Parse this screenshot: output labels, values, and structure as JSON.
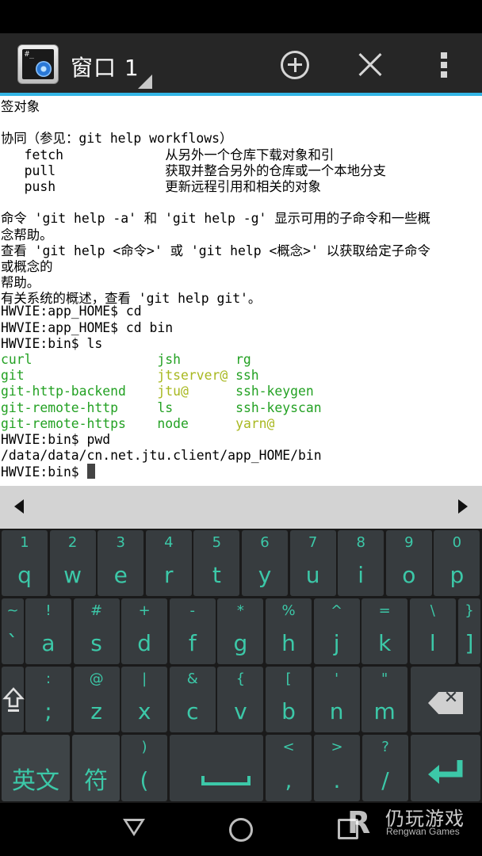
{
  "action_bar": {
    "title": "窗口 1",
    "icons": [
      "terminal-app-icon",
      "add-icon",
      "close-icon",
      "overflow-menu-icon"
    ]
  },
  "terminal": {
    "lines": [
      [
        {
          "t": "签对象",
          "c": ""
        }
      ],
      [
        {
          "t": "",
          "c": ""
        }
      ],
      [
        {
          "t": "协同（参见：git help workflows）",
          "c": ""
        }
      ],
      [
        {
          "t": "   fetch             从另外一个仓库下载对象和引",
          "c": ""
        }
      ],
      [
        {
          "t": "   pull              获取并整合另外的仓库或一个本地分支",
          "c": ""
        }
      ],
      [
        {
          "t": "   push              更新远程引用和相关的对象",
          "c": ""
        }
      ],
      [
        {
          "t": "",
          "c": ""
        }
      ],
      [
        {
          "t": "命令 'git help -a' 和 'git help -g' 显示可用的子命令和一些概",
          "c": ""
        }
      ],
      [
        {
          "t": "念帮助。",
          "c": ""
        }
      ],
      [
        {
          "t": "查看 'git help <命令>' 或 'git help <概念>' 以获取给定子命令",
          "c": ""
        }
      ],
      [
        {
          "t": "或概念的",
          "c": ""
        }
      ],
      [
        {
          "t": "帮助。",
          "c": ""
        }
      ],
      [
        {
          "t": "有关系统的概述，查看 'git help git'。",
          "c": ""
        }
      ],
      [
        {
          "t": "HWVIE:app_HOME$ cd",
          "c": ""
        }
      ],
      [
        {
          "t": "HWVIE:app_HOME$ cd bin",
          "c": ""
        }
      ],
      [
        {
          "t": "HWVIE:bin$ ls",
          "c": ""
        }
      ],
      [
        {
          "t": "curl              ",
          "c": "green"
        },
        {
          "t": "  ",
          "c": ""
        },
        {
          "t": "jsh",
          "c": "green"
        },
        {
          "t": "       ",
          "c": ""
        },
        {
          "t": "rg",
          "c": "green"
        }
      ],
      [
        {
          "t": "git               ",
          "c": "green"
        },
        {
          "t": "  ",
          "c": ""
        },
        {
          "t": "jtserver@",
          "c": "yellow"
        },
        {
          "t": " ",
          "c": ""
        },
        {
          "t": "ssh",
          "c": "green"
        }
      ],
      [
        {
          "t": "git-http-backend  ",
          "c": "green"
        },
        {
          "t": "  ",
          "c": ""
        },
        {
          "t": "jtu@",
          "c": "yellow"
        },
        {
          "t": "      ",
          "c": ""
        },
        {
          "t": "ssh-keygen",
          "c": "green"
        }
      ],
      [
        {
          "t": "git-remote-http   ",
          "c": "green"
        },
        {
          "t": "  ",
          "c": ""
        },
        {
          "t": "ls",
          "c": "green"
        },
        {
          "t": "        ",
          "c": ""
        },
        {
          "t": "ssh-keyscan",
          "c": "green"
        }
      ],
      [
        {
          "t": "git-remote-https  ",
          "c": "green"
        },
        {
          "t": "  ",
          "c": ""
        },
        {
          "t": "node",
          "c": "green"
        },
        {
          "t": "      ",
          "c": ""
        },
        {
          "t": "yarn@",
          "c": "yellow"
        }
      ],
      [
        {
          "t": "HWVIE:bin$ pwd",
          "c": ""
        }
      ],
      [
        {
          "t": "/data/data/cn.net.jtu.client/app_HOME/bin",
          "c": ""
        }
      ],
      [
        {
          "t": "HWVIE:bin$ ",
          "c": ""
        }
      ]
    ],
    "colors": {
      "green": "#23a123",
      "yellow": "#a8b820"
    }
  },
  "keyboard": {
    "row1": [
      [
        "1",
        "q"
      ],
      [
        "2",
        "w"
      ],
      [
        "3",
        "e"
      ],
      [
        "4",
        "r"
      ],
      [
        "5",
        "t"
      ],
      [
        "6",
        "y"
      ],
      [
        "7",
        "u"
      ],
      [
        "8",
        "i"
      ],
      [
        "9",
        "o"
      ],
      [
        "0",
        "p"
      ]
    ],
    "row2": [
      [
        "~",
        "`"
      ],
      [
        "!",
        "a"
      ],
      [
        "#",
        "s"
      ],
      [
        "+",
        "d"
      ],
      [
        "-",
        "f"
      ],
      [
        "*",
        "g"
      ],
      [
        "%",
        "h"
      ],
      [
        "^",
        "j"
      ],
      [
        "=",
        "k"
      ],
      [
        "\\",
        "l"
      ],
      [
        "}",
        "]"
      ]
    ],
    "row3": [
      [
        ":",
        ";"
      ],
      [
        "@",
        "z"
      ],
      [
        "|",
        "x"
      ],
      [
        "&",
        "c"
      ],
      [
        "{",
        "v"
      ],
      [
        "[",
        "b"
      ],
      [
        "'",
        "n"
      ],
      [
        "\"",
        "m"
      ]
    ],
    "row4": {
      "lang": "英文",
      "sym": "符",
      "paren": [
        ")",
        "("
      ],
      "comma": [
        "<",
        ","
      ],
      "period": [
        ">",
        "."
      ],
      "slash": [
        "?",
        "/"
      ]
    },
    "accent_color": "#3cc8a8"
  },
  "watermark": {
    "cn": "仍玩游戏",
    "en": "Rengwan Games"
  }
}
